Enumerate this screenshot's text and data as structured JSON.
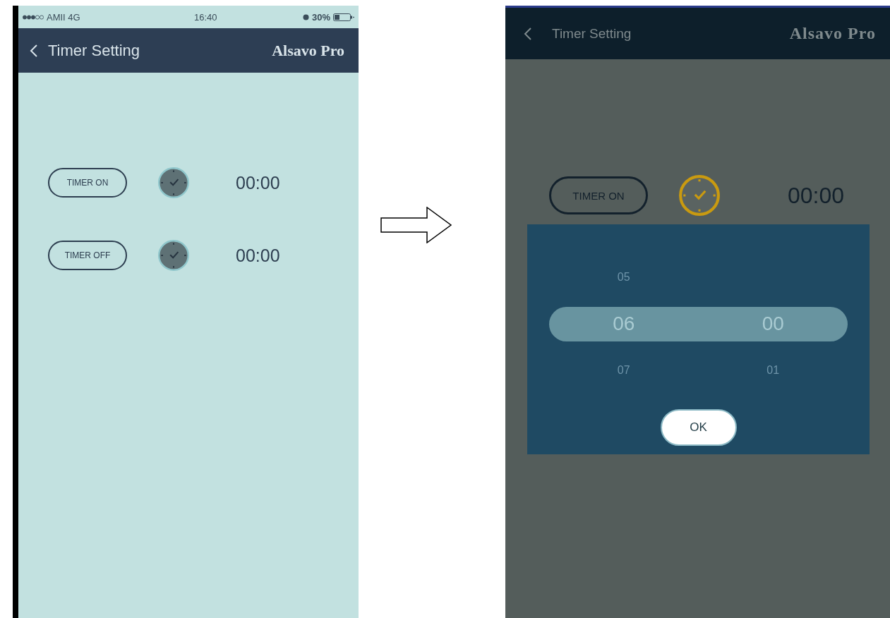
{
  "before_screen": {
    "dimmed": false,
    "status_bar": {
      "carrier": "AMII 4G",
      "time": "16:40",
      "battery": "30%"
    },
    "nav": {
      "title": "Timer Setting",
      "brand": "Alsavo Pro"
    },
    "timers": [
      {
        "label": "TIMER ON",
        "time": "00:00",
        "highlighted": false
      },
      {
        "label": "TIMER OFF",
        "time": "00:00",
        "highlighted": false
      }
    ]
  },
  "after_screen": {
    "dimmed": true,
    "nav": {
      "title": "Timer Setting",
      "brand": "Alsavo Pro"
    },
    "timers": [
      {
        "label": "TIMER ON",
        "time": "00:00",
        "highlighted": true
      }
    ],
    "picker": {
      "rows": [
        {
          "hour": "05",
          "selected": false
        },
        {
          "hour": "06",
          "minute": "00",
          "selected": true
        },
        {
          "hour": "07",
          "minute": "01",
          "selected": false
        }
      ],
      "button": "OK"
    }
  }
}
